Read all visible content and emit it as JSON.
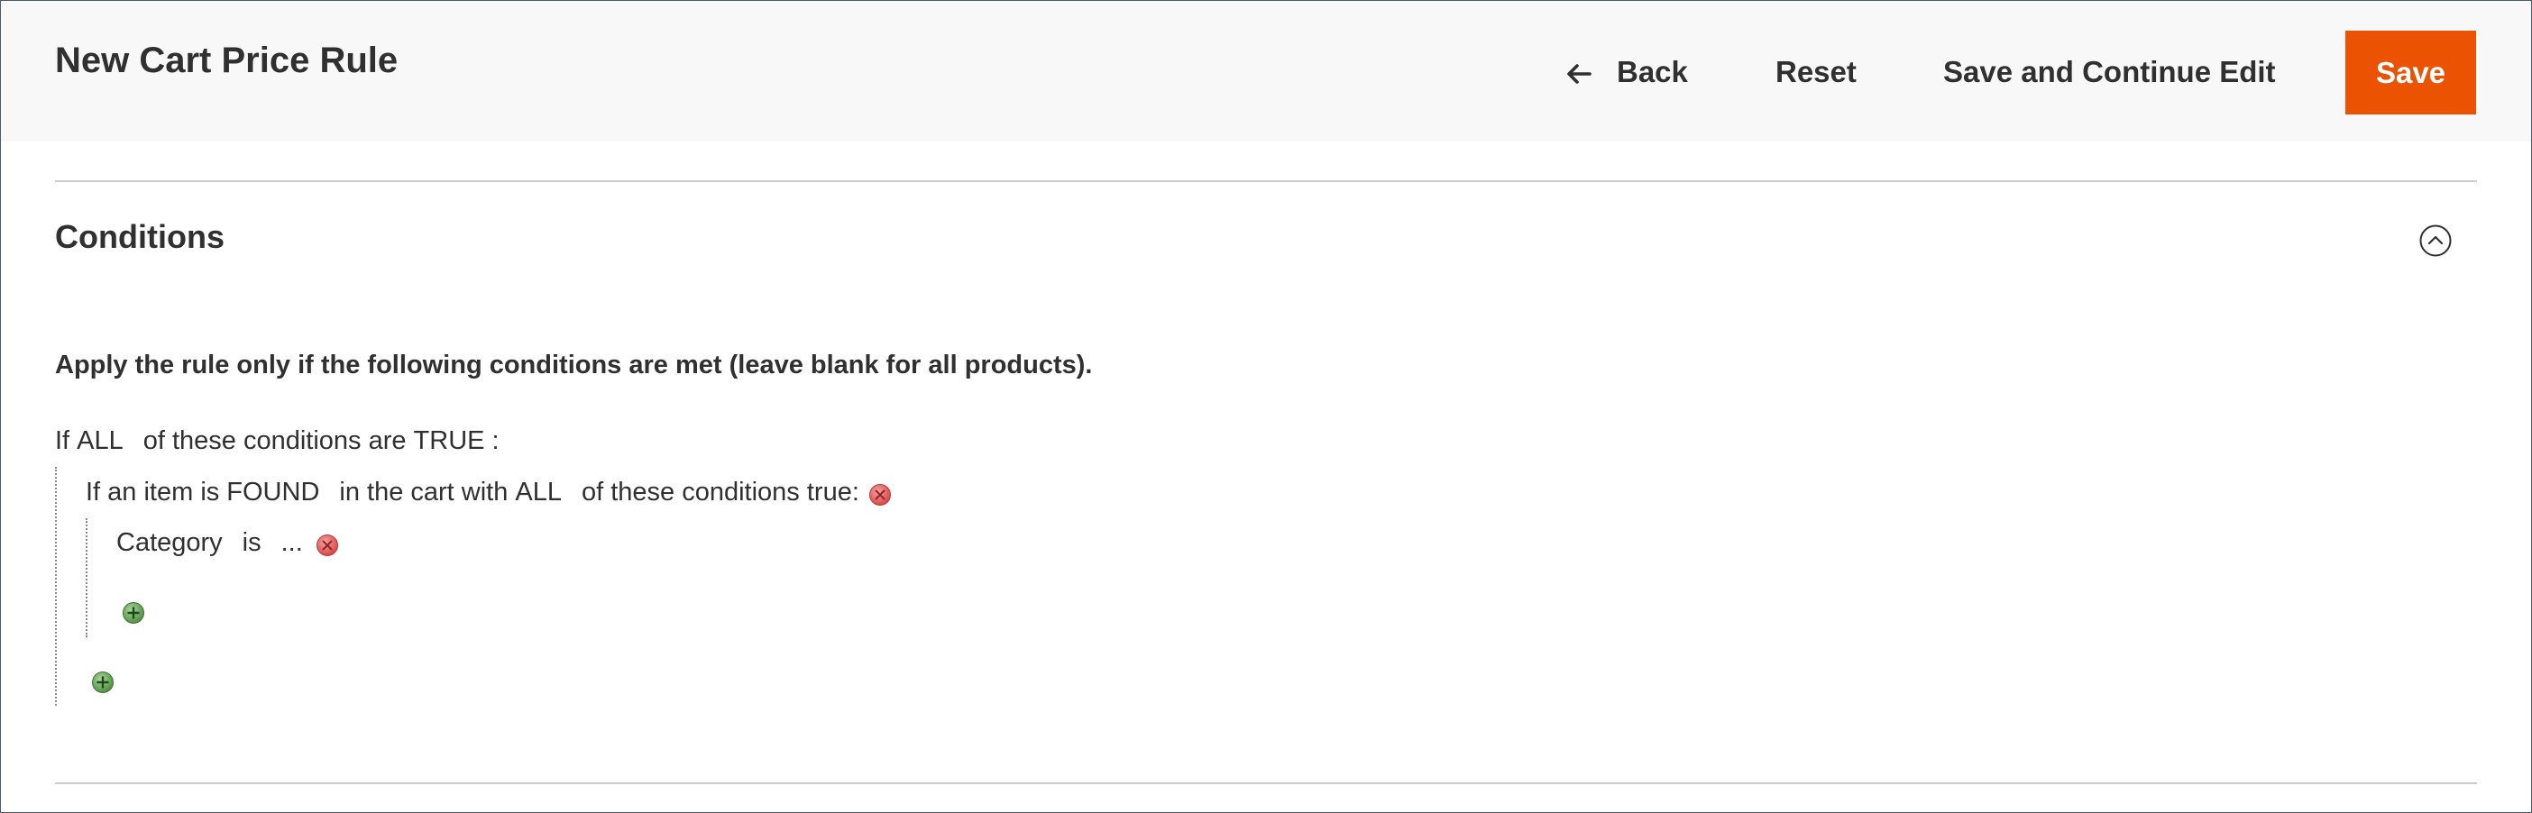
{
  "header": {
    "title": "New Cart Price Rule",
    "actions": {
      "back_label": "Back",
      "back_icon": "arrow-left-icon",
      "reset_label": "Reset",
      "save_continue_label": "Save and Continue Edit",
      "save_label": "Save"
    }
  },
  "colors": {
    "primary_button": "#eb5202",
    "header_background": "#f8f8f8",
    "text": "#303030",
    "remove_icon": "#e35d5d",
    "add_icon": "#5a9a4c"
  },
  "conditions_section": {
    "title": "Conditions",
    "collapse_icon": "chevron-up-circle-icon",
    "intro": "Apply the rule only if the following conditions are met (leave blank for all products).",
    "root": {
      "prefix": "If",
      "aggregator": "ALL",
      "middle": "of these conditions are",
      "value": "TRUE",
      "suffix": ":"
    },
    "found_condition": {
      "prefix": "If an item is",
      "found_value": "FOUND",
      "middle": "in the cart with",
      "aggregator": "ALL",
      "suffix": "of these conditions true:",
      "remove_icon": "remove-icon"
    },
    "category_condition": {
      "attribute": "Category",
      "operator": "is",
      "value": "...",
      "remove_icon": "remove-icon"
    },
    "add_icon": "add-icon"
  }
}
